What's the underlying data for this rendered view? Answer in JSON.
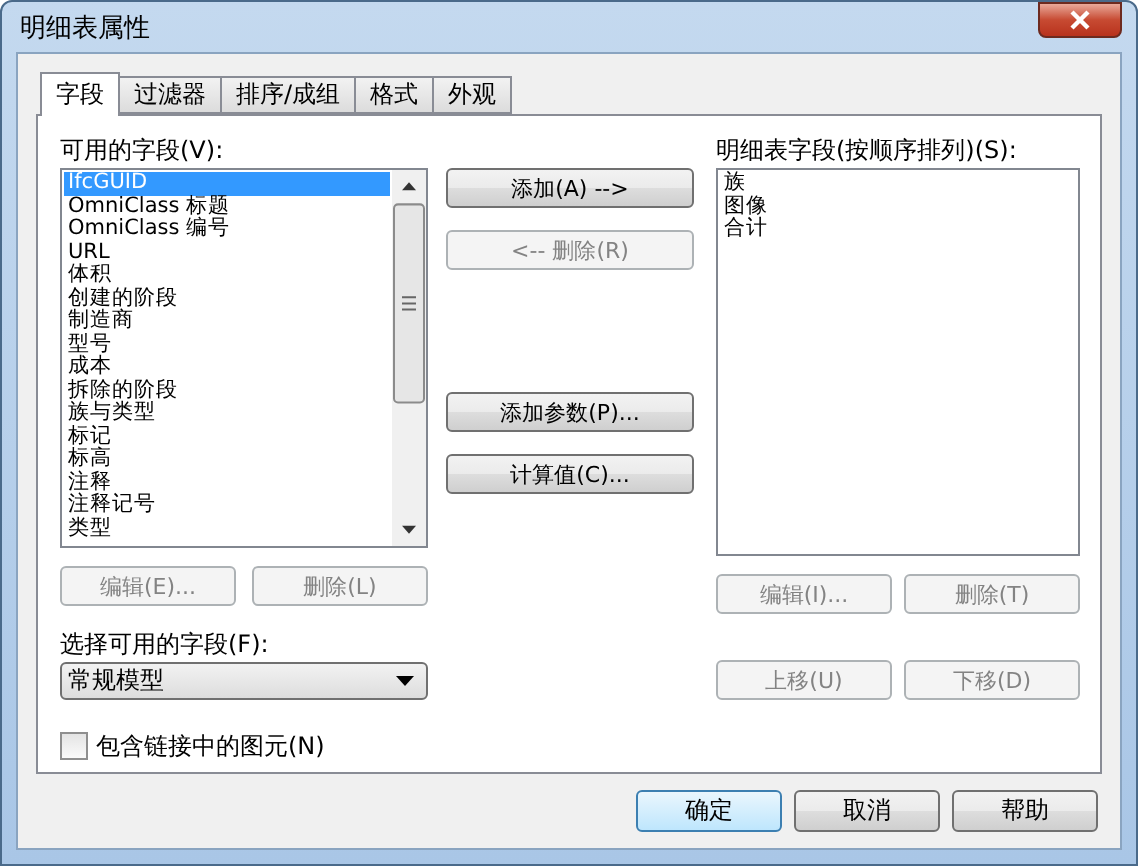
{
  "window": {
    "title": "明细表属性"
  },
  "tabs": [
    {
      "label": "字段",
      "selected": true
    },
    {
      "label": "过滤器",
      "selected": false
    },
    {
      "label": "排序/成组",
      "selected": false
    },
    {
      "label": "格式",
      "selected": false
    },
    {
      "label": "外观",
      "selected": false
    }
  ],
  "available": {
    "label": "可用的字段(V):",
    "items": [
      {
        "label": "IfcGUID",
        "selected": true
      },
      {
        "label": "OmniClass 标题",
        "selected": false
      },
      {
        "label": "OmniClass 编号",
        "selected": false
      },
      {
        "label": "URL",
        "selected": false
      },
      {
        "label": "体积",
        "selected": false
      },
      {
        "label": "创建的阶段",
        "selected": false
      },
      {
        "label": "制造商",
        "selected": false
      },
      {
        "label": "型号",
        "selected": false
      },
      {
        "label": "成本",
        "selected": false
      },
      {
        "label": "拆除的阶段",
        "selected": false
      },
      {
        "label": "族与类型",
        "selected": false
      },
      {
        "label": "标记",
        "selected": false
      },
      {
        "label": "标高",
        "selected": false
      },
      {
        "label": "注释",
        "selected": false
      },
      {
        "label": "注释记号",
        "selected": false
      },
      {
        "label": "类型",
        "selected": false
      }
    ],
    "buttons": [
      {
        "label": "编辑(E)...",
        "disabled": true
      },
      {
        "label": "删除(L)",
        "disabled": true
      }
    ]
  },
  "middle_buttons": [
    {
      "label": "添加(A) -->",
      "disabled": false
    },
    {
      "label": "<-- 删除(R)",
      "disabled": true
    },
    {
      "label": "添加参数(P)...",
      "disabled": false
    },
    {
      "label": "计算值(C)...",
      "disabled": false
    }
  ],
  "schedule": {
    "label": "明细表字段(按顺序排列)(S):",
    "items": [
      {
        "label": "族",
        "selected": false
      },
      {
        "label": "图像",
        "selected": false
      },
      {
        "label": "合计",
        "selected": false
      }
    ],
    "buttons": [
      {
        "label": "编辑(I)...",
        "disabled": true
      },
      {
        "label": "删除(T)",
        "disabled": true
      }
    ],
    "move_buttons": [
      {
        "label": "上移(U)",
        "disabled": true
      },
      {
        "label": "下移(D)",
        "disabled": true
      }
    ]
  },
  "select_fields": {
    "label": "选择可用的字段(F):",
    "value": "常规模型"
  },
  "include_linked": {
    "label": "包含链接中的图元(N)",
    "checked": false
  },
  "footer_buttons": [
    {
      "label": "确定",
      "default": true
    },
    {
      "label": "取消",
      "default": false
    },
    {
      "label": "帮助",
      "default": false
    }
  ]
}
